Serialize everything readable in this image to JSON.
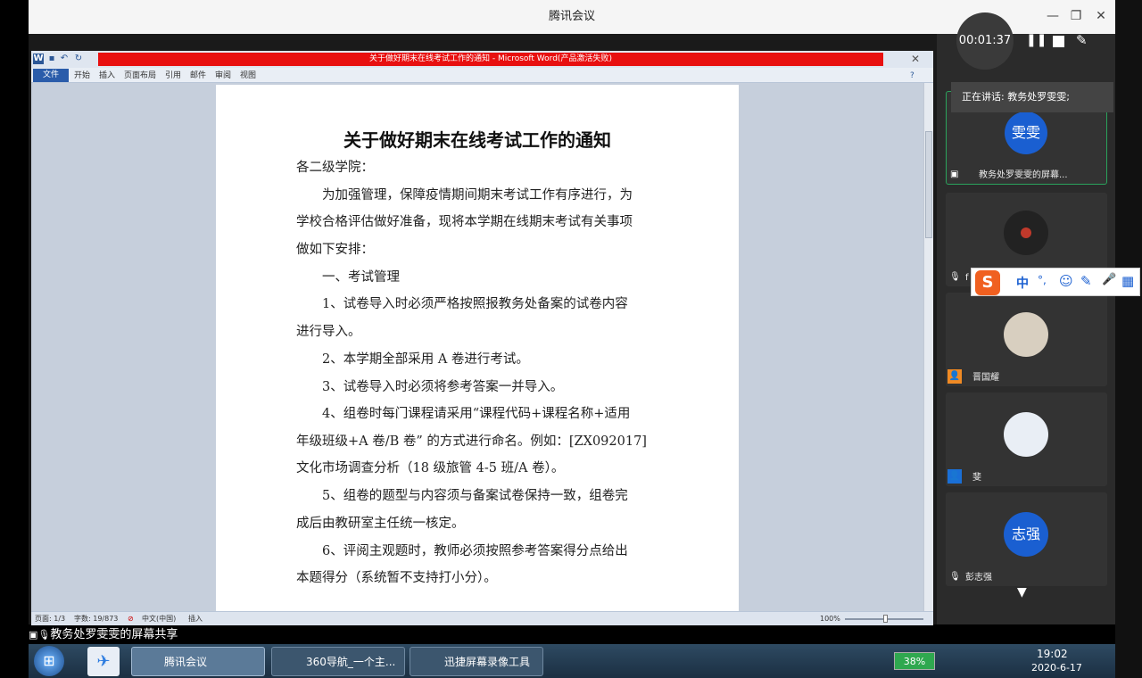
{
  "app_title": "腾讯会议",
  "window_controls": {
    "minimize": "—",
    "restore": "❐",
    "close": "✕"
  },
  "timer": "00:01:37",
  "speaking": "正在讲话: 教务处罗雯雯;",
  "word": {
    "title": "关于做好期末在线考试工作的通知 - Microsoft Word(产品激活失败)",
    "tabs": [
      "文件",
      "开始",
      "插入",
      "页面布局",
      "引用",
      "邮件",
      "审阅",
      "视图"
    ],
    "status": {
      "page": "页面: 1/3",
      "words": "字数: 19/873",
      "lang": "中文(中国)",
      "mode": "插入",
      "zoom": "100%"
    }
  },
  "document": {
    "title": "关于做好期末在线考试工作的通知",
    "lines": [
      "各二级学院：",
      "　　为加强管理，保障疫情期间期末考试工作有序进行，为",
      "学校合格评估做好准备，现将本学期在线期末考试有关事项",
      "做如下安排：",
      "　　一、考试管理",
      "　　1、试卷导入时必须严格按照报教务处备案的试卷内容",
      "进行导入。",
      "　　2、本学期全部采用 A 卷进行考试。",
      "　　3、试卷导入时必须将参考答案一并导入。",
      "　　4、组卷时每门课程请采用“课程代码+课程名称+适用",
      "年级班级+A 卷/B 卷” 的方式进行命名。例如：[ZX092017]",
      "文化市场调查分析（18 级旅管 4-5 班/A 卷）。",
      "　　5、组卷的题型与内容须与备案试卷保持一致，组卷完",
      "成后由教研室主任统一核定。",
      "　　6、评阅主观题时，教师必须按照参考答案得分点给出",
      "本题得分（系统暂不支持打小分）。"
    ]
  },
  "participants": [
    {
      "avatar_text": "雯雯",
      "name": "教务处罗雯雯的屏幕...",
      "color": "#1a5fd1"
    },
    {
      "avatar_text": "",
      "name": "f",
      "color": "#222222"
    },
    {
      "avatar_text": "",
      "name": "晋国耀",
      "color": "#d8cfc0"
    },
    {
      "avatar_text": "",
      "name": "斐",
      "color": "#e9eef5"
    },
    {
      "avatar_text": "志强",
      "name": "彭志强",
      "color": "#1a5fd1"
    }
  ],
  "ime": {
    "logo": "S",
    "items": [
      "中",
      "°,",
      "☺",
      "✎",
      "🎤",
      "▦"
    ]
  },
  "share_label": "教务处罗雯雯的屏幕共享",
  "taskbar": {
    "items": [
      "腾讯会议",
      "360导航_一个主...",
      "迅捷屏幕录像工具"
    ],
    "battery": "38%",
    "time": "19:02",
    "date": "2020-6-17"
  }
}
